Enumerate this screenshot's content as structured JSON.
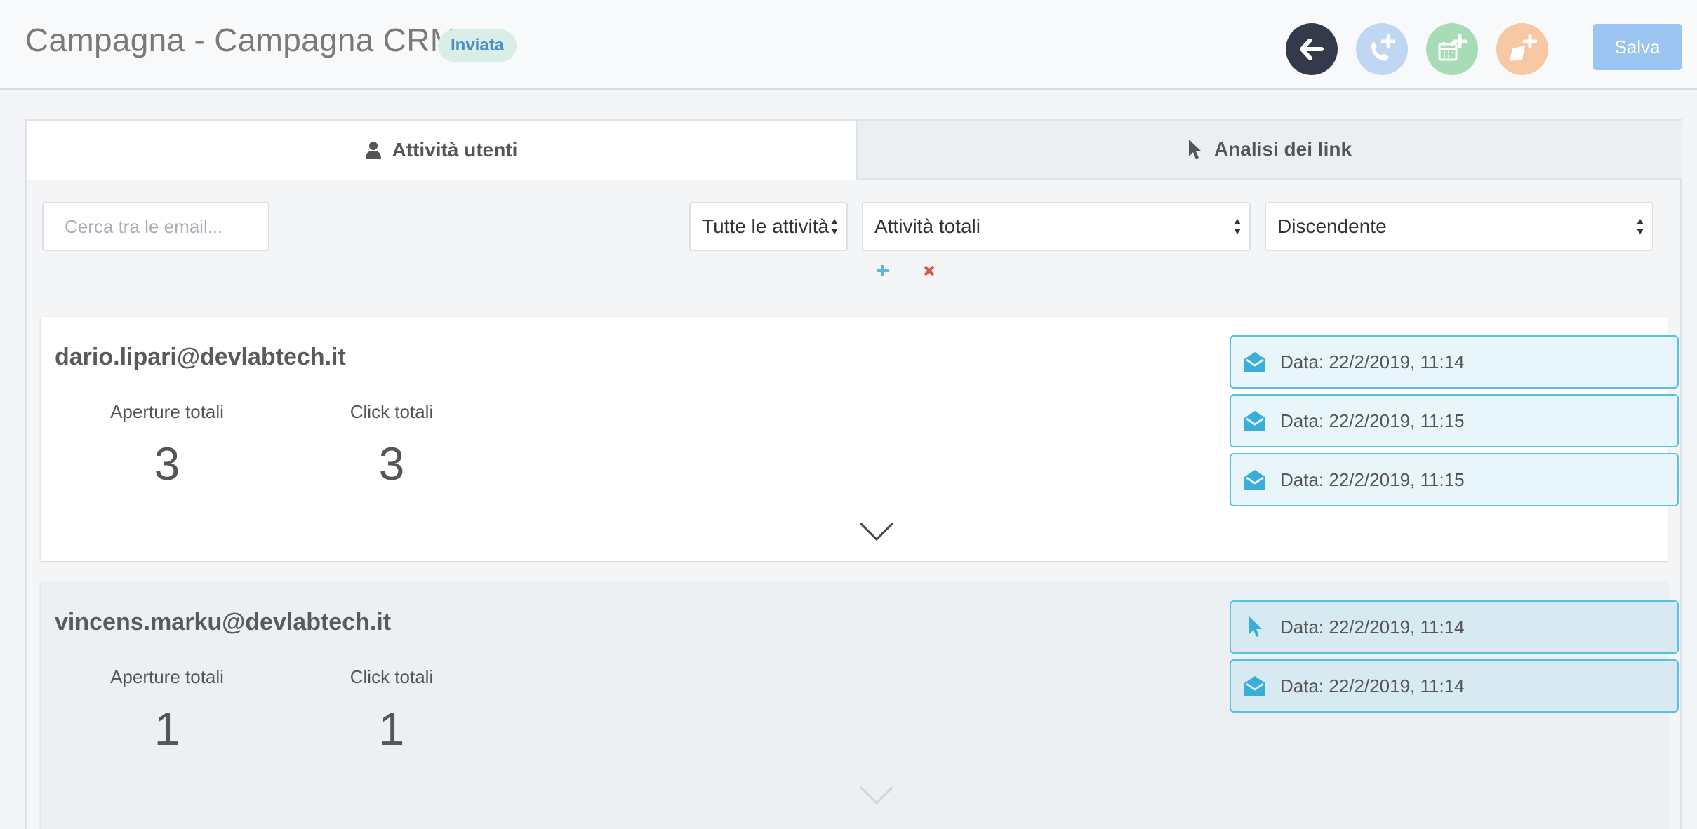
{
  "header": {
    "title": "Campagna - Campagna CRM",
    "status": "Inviata",
    "save_label": "Salva",
    "colors": {
      "back": "#343a4a",
      "call": "#bfd7f3",
      "calendar": "#a8dcb6",
      "note": "#f8c7a3",
      "save": "#9cc4f0"
    }
  },
  "tabs": [
    {
      "label": "Attività utenti",
      "icon": "user-icon",
      "active": true
    },
    {
      "label": "Analisi dei link",
      "icon": "cursor-icon",
      "active": false
    }
  ],
  "filters": {
    "search_placeholder": "Cerca tra le email...",
    "activity_type": "Tutte le attività",
    "metric": "Attività totali",
    "order": "Discendente"
  },
  "users": [
    {
      "email": "dario.lipari@devlabtech.it",
      "opens_label": "Aperture totali",
      "opens": "3",
      "clicks_label": "Click totali",
      "clicks": "3",
      "events": [
        {
          "type": "envelope-open-icon",
          "text": "Data: 22/2/2019, 11:14"
        },
        {
          "type": "envelope-open-icon",
          "text": "Data: 22/2/2019, 11:15"
        },
        {
          "type": "envelope-open-icon",
          "text": "Data: 22/2/2019, 11:15"
        }
      ]
    },
    {
      "email": "vincens.marku@devlabtech.it",
      "opens_label": "Aperture totali",
      "opens": "1",
      "clicks_label": "Click totali",
      "clicks": "1",
      "events": [
        {
          "type": "cursor-icon",
          "text": "Data: 22/2/2019, 11:14"
        },
        {
          "type": "envelope-open-icon",
          "text": "Data: 22/2/2019, 11:14"
        }
      ]
    }
  ]
}
